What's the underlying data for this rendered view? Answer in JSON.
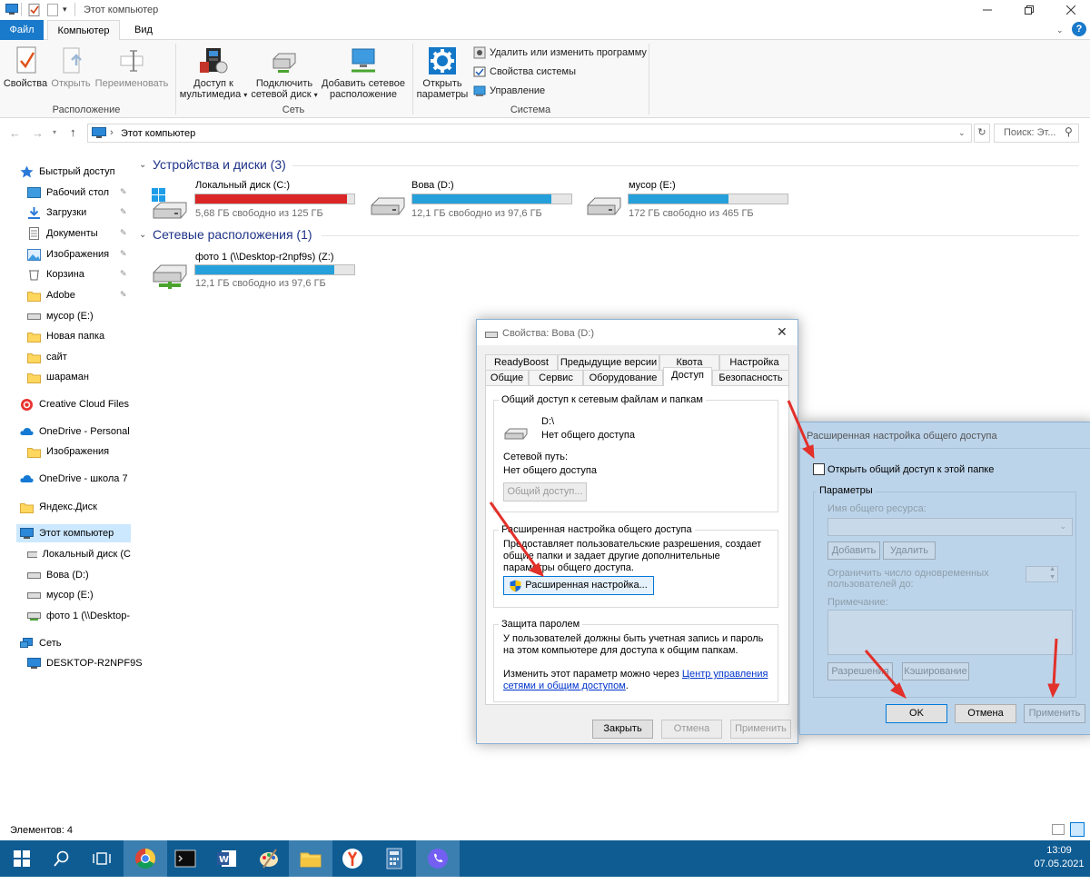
{
  "window": {
    "title": "Этот компьютер"
  },
  "ribbon": {
    "tabs": [
      {
        "label": "Файл"
      },
      {
        "label": "Компьютер"
      },
      {
        "label": "Вид"
      }
    ],
    "groups": {
      "location": {
        "label": "Расположение",
        "buttons": [
          "Свойства",
          "Открыть",
          "Переименовать"
        ]
      },
      "network": {
        "label": "Сеть",
        "media_line1": "Доступ к",
        "media_line2": "мультимедиа",
        "map_line1": "Подключить",
        "map_line2": "сетевой диск",
        "add_line1": "Добавить сетевое",
        "add_line2": "расположение"
      },
      "system": {
        "label": "Система",
        "open_line1": "Открыть",
        "open_line2": "параметры",
        "items": [
          "Удалить или изменить программу",
          "Свойства системы",
          "Управление"
        ]
      }
    }
  },
  "address": {
    "path": "Этот компьютер",
    "search_placeholder": "Поиск: Эт..."
  },
  "nav": {
    "items": [
      {
        "label": "Быстрый доступ"
      },
      {
        "label": "Рабочий стол"
      },
      {
        "label": "Загрузки"
      },
      {
        "label": "Документы"
      },
      {
        "label": "Изображения"
      },
      {
        "label": "Корзина"
      },
      {
        "label": "Adobe"
      },
      {
        "label": "мусор (E:)"
      },
      {
        "label": "Новая папка"
      },
      {
        "label": "сайт"
      },
      {
        "label": "шараман"
      },
      {
        "label": "Creative Cloud Files"
      },
      {
        "label": "OneDrive - Personal"
      },
      {
        "label": "Изображения"
      },
      {
        "label": "OneDrive - школа 7"
      },
      {
        "label": "Яндекс.Диск"
      },
      {
        "label": "Этот компьютер"
      },
      {
        "label": "Локальный диск (C"
      },
      {
        "label": "Вова (D:)"
      },
      {
        "label": "мусор (E:)"
      },
      {
        "label": "фото 1 (\\\\Desktop-"
      },
      {
        "label": "Сеть"
      },
      {
        "label": "DESKTOP-R2NPF9S"
      }
    ]
  },
  "main": {
    "devices_header": "Устройства и диски (3)",
    "network_header": "Сетевые расположения (1)",
    "drives": [
      {
        "name": "Локальный диск (C:)",
        "free": "5,68 ГБ свободно из 125 ГБ",
        "used_fraction": 0.955,
        "color": "#da2626"
      },
      {
        "name": "Вова (D:)",
        "free": "12,1 ГБ свободно из 97,6 ГБ",
        "used_fraction": 0.876,
        "color": "#26a0da"
      },
      {
        "name": "мусор (E:)",
        "free": "172 ГБ свободно из 465 ГБ",
        "used_fraction": 0.63,
        "color": "#26a0da"
      }
    ],
    "network_drives": [
      {
        "name": "фото 1 (\\\\Desktop-r2npf9s) (Z:)",
        "free": "12,1 ГБ свободно из 97,6 ГБ",
        "used_fraction": 0.876,
        "color": "#26a0da"
      }
    ]
  },
  "status": {
    "items": "Элементов: 4"
  },
  "taskbar": {
    "time": "13:09",
    "date": "07.05.2021"
  },
  "props_dialog": {
    "title": "Свойства: Вова (D:)",
    "tabs_row1": [
      "ReadyBoost",
      "Предыдущие версии",
      "Квота",
      "Настройка"
    ],
    "tabs_row2": [
      "Общие",
      "Сервис",
      "Оборудование",
      "Доступ",
      "Безопасность"
    ],
    "share_group": "Общий доступ к сетевым файлам и папкам",
    "drive_path": "D:\\",
    "share_state": "Нет общего доступа",
    "net_path_label": "Сетевой путь:",
    "net_path_value": "Нет общего доступа",
    "share_button": "Общий доступ...",
    "adv_group": "Расширенная настройка общего доступа",
    "adv_desc": "Предоставляет пользовательские разрешения, создает общие папки и задает другие дополнительные параметры общего доступа.",
    "adv_button": "Расширенная настройка...",
    "pw_group": "Защита паролем",
    "pw_desc": "У пользователей должны быть учетная запись и пароль на этом компьютере для доступа к общим папкам.",
    "pw_change": "Изменить этот параметр можно через",
    "pw_link": "Центр управления сетями и общим доступом",
    "pw_dot": ".",
    "close": "Закрыть",
    "cancel": "Отмена",
    "apply": "Применить"
  },
  "adv_dialog": {
    "title": "Расширенная настройка общего доступа",
    "checkbox": "Открыть общий доступ к этой папке",
    "params": "Параметры",
    "share_name": "Имя общего ресурса:",
    "add": "Добавить",
    "remove": "Удалить",
    "limit": "Ограничить число одновременных пользователей до:",
    "comment": "Примечание:",
    "permissions": "Разрешения",
    "caching": "Кэширование",
    "ok": "OK",
    "cancel": "Отмена",
    "apply": "Применить"
  }
}
